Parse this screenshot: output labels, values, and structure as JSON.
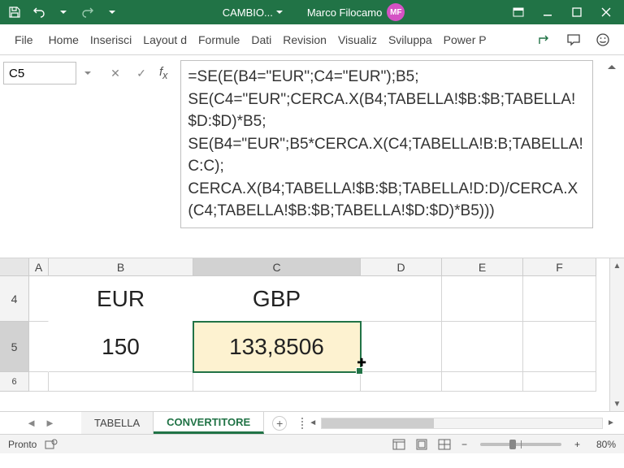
{
  "titlebar": {
    "filename": "CAMBIO...",
    "username": "Marco Filocamo",
    "user_initials": "MF"
  },
  "ribbon": {
    "tabs": [
      "File",
      "Home",
      "Inserisci",
      "Layout d",
      "Formule",
      "Dati",
      "Revision",
      "Visualiz",
      "Sviluppa",
      "Power P"
    ]
  },
  "name_box": "C5",
  "formula": "=SE(E(B4=\"EUR\";C4=\"EUR\");B5;\nSE(C4=\"EUR\";CERCA.X(B4;TABELLA!$B:$B;TABELLA!$D:$D)*B5;\nSE(B4=\"EUR\";B5*CERCA.X(C4;TABELLA!B:B;TABELLA!C:C);\nCERCA.X(B4;TABELLA!$B:$B;TABELLA!D:D)/CERCA.X(C4;TABELLA!$B:$B;TABELLA!$D:$D)*B5)))",
  "columns": [
    "A",
    "B",
    "C",
    "D",
    "E",
    "F"
  ],
  "rows": [
    "4",
    "5",
    "6"
  ],
  "cells": {
    "B4": "EUR",
    "C4": "GBP",
    "B5": "150",
    "C5": "133,8506"
  },
  "sheets": {
    "tab1": "TABELLA",
    "tab2": "CONVERTITORE"
  },
  "status": {
    "ready": "Pronto",
    "zoom": "80%"
  }
}
